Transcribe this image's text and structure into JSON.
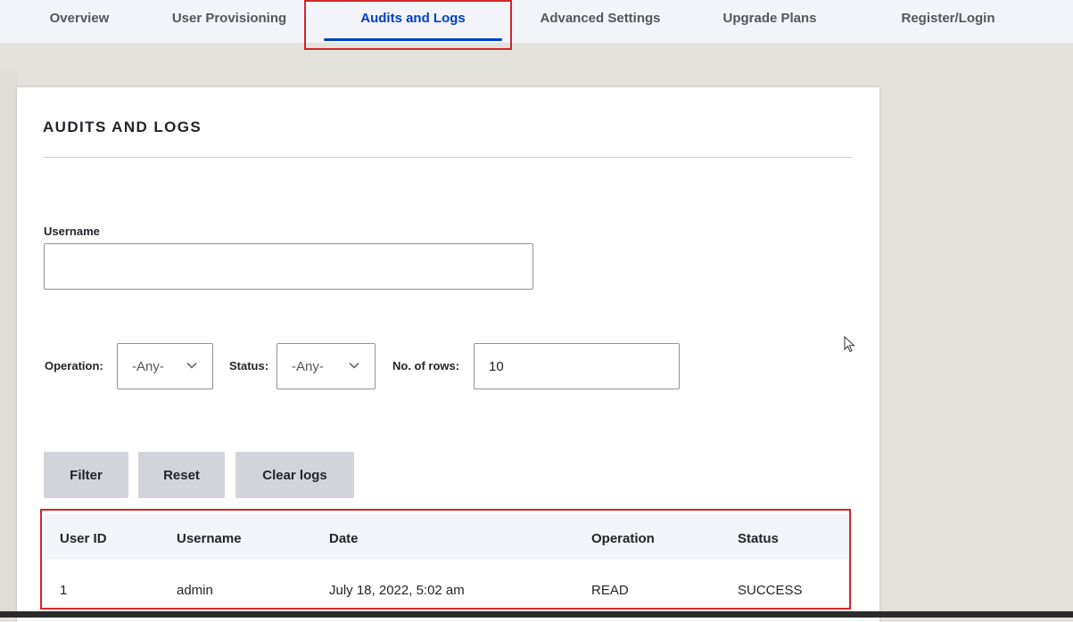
{
  "tabs": [
    {
      "label": "Overview",
      "active": false
    },
    {
      "label": "User Provisioning",
      "active": false
    },
    {
      "label": "Audits and Logs",
      "active": true
    },
    {
      "label": "Advanced Settings",
      "active": false
    },
    {
      "label": "Upgrade Plans",
      "active": false
    },
    {
      "label": "Register/Login",
      "active": false
    }
  ],
  "page": {
    "title": "AUDITS AND LOGS"
  },
  "filters": {
    "username_label": "Username",
    "username_value": "",
    "operation_label": "Operation:",
    "operation_value": "-Any-",
    "status_label": "Status:",
    "status_value": "-Any-",
    "rows_label": "No. of rows:",
    "rows_value": "10"
  },
  "buttons": {
    "filter": "Filter",
    "reset": "Reset",
    "clear_logs": "Clear logs"
  },
  "table": {
    "headers": [
      "User ID",
      "Username",
      "Date",
      "Operation",
      "Status"
    ],
    "rows": [
      [
        "1",
        "admin",
        "July 18, 2022, 5:02 am",
        "READ",
        "SUCCESS"
      ]
    ]
  },
  "colors": {
    "accent": "#003ecc",
    "highlight": "#d4252a"
  },
  "icons": {
    "dropdown": "chevron-down-icon",
    "cursor": "mouse-pointer-icon"
  }
}
